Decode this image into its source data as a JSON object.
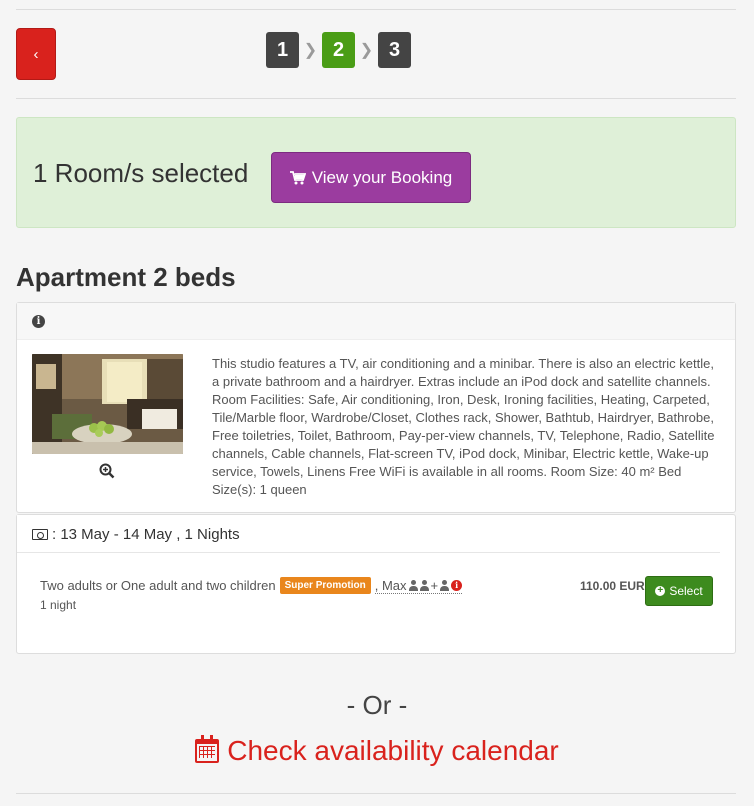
{
  "nav": {
    "back_label": "‹"
  },
  "steps": [
    {
      "label": "1",
      "active": false
    },
    {
      "label": "2",
      "active": true
    },
    {
      "label": "3",
      "active": false
    }
  ],
  "booking_alert": {
    "text": "1 Room/s selected",
    "view_button_label": "View your Booking",
    "button_icon": "cart-icon"
  },
  "room": {
    "title": "Apartment 2 beds",
    "description": "This studio features a TV, air conditioning and a minibar. There is also an electric kettle, a private bathroom and a hairdryer. Extras include an iPod dock and satellite channels. Room Facilities: Safe, Air conditioning, Iron, Desk, Ironing facilities, Heating, Carpeted, Tile/Marble floor, Wardrobe/Closet, Clothes rack, Shower, Bathtub, Hairdryer, Bathrobe, Free toiletries, Toilet, Bathroom, Pay-per-view channels, TV, Telephone, Radio, Satellite channels, Cable channels, Flat-screen TV, iPod dock, Minibar, Electric kettle, Wake-up service, Towels, Linens Free WiFi is available in all rooms. Room Size: 40 m² Bed Size(s): 1 queen"
  },
  "availability": {
    "dates": ": 13 May - 14 May , 1 Nights",
    "rate": {
      "occupancy": "Two adults or One adult and two children",
      "promo_badge": "Super Promotion",
      "max_label": ", Max",
      "plus": "+",
      "nights": "1 night",
      "price": "110.00 EUR",
      "select_label": "Select"
    }
  },
  "footer": {
    "or_text": "- Or -",
    "calendar_link": "Check availability calendar"
  },
  "colors": {
    "accent_red": "#d9221d",
    "step_active": "#4a9d16",
    "view_button": "#9b3c9f",
    "alert_bg": "#dff0d8",
    "promo": "#e9861c",
    "select_green": "#3d8b1e"
  }
}
